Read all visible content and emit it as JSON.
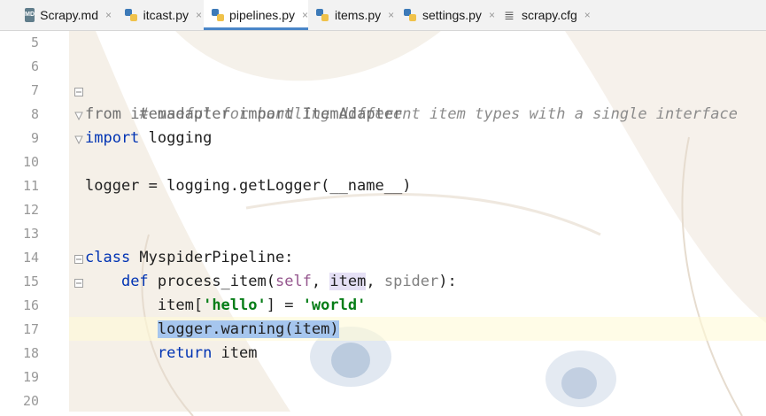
{
  "tabs": [
    {
      "label": "Scrapy.md",
      "icon": "markdown-file-icon",
      "active": false
    },
    {
      "label": "itcast.py",
      "icon": "python-file-icon",
      "active": false
    },
    {
      "label": "pipelines.py",
      "icon": "python-file-icon",
      "active": true
    },
    {
      "label": "items.py",
      "icon": "python-file-icon",
      "active": false
    },
    {
      "label": "settings.py",
      "icon": "python-file-icon",
      "active": false
    },
    {
      "label": "scrapy.cfg",
      "icon": "config-file-icon",
      "active": false
    }
  ],
  "tab_close_glyph": "×",
  "line_numbers": [
    "5",
    "6",
    "7",
    "8",
    "9",
    "10",
    "11",
    "12",
    "13",
    "14",
    "15",
    "16",
    "17",
    "18",
    "19",
    "20"
  ],
  "code": {
    "l7_comment": "# useful for handling different item types with a single interface",
    "l8_from": "from",
    "l8_module": " itemadapter ",
    "l8_import": "import",
    "l8_name": " ItemAdapter",
    "l9_import": "import",
    "l9_name": " logging",
    "l11_text": "logger = logging.getLogger(__name__)",
    "l14_class": "class",
    "l14_name": " MyspiderPipeline:",
    "l15_indent": "    ",
    "l15_def": "def",
    "l15_fn": " process_item(",
    "l15_self": "self",
    "l15_sep1": ", ",
    "l15_item": "item",
    "l15_sep2": ", ",
    "l15_spider": "spider",
    "l15_end": "):",
    "l16_indent": "        ",
    "l16_pre": "item[",
    "l16_key": "'hello'",
    "l16_mid": "] = ",
    "l16_val": "'world'",
    "l17_indent": "        ",
    "l17_text": "logger.warning(item)",
    "l18_indent": "        ",
    "l18_return": "return",
    "l18_item": " item"
  },
  "colors": {
    "keyword": "#0033b3",
    "comment": "#8c8c8c",
    "string": "#067d17",
    "self": "#94558d",
    "selection": "#a6c6ee",
    "active_tab_underline": "#4a86c8"
  }
}
